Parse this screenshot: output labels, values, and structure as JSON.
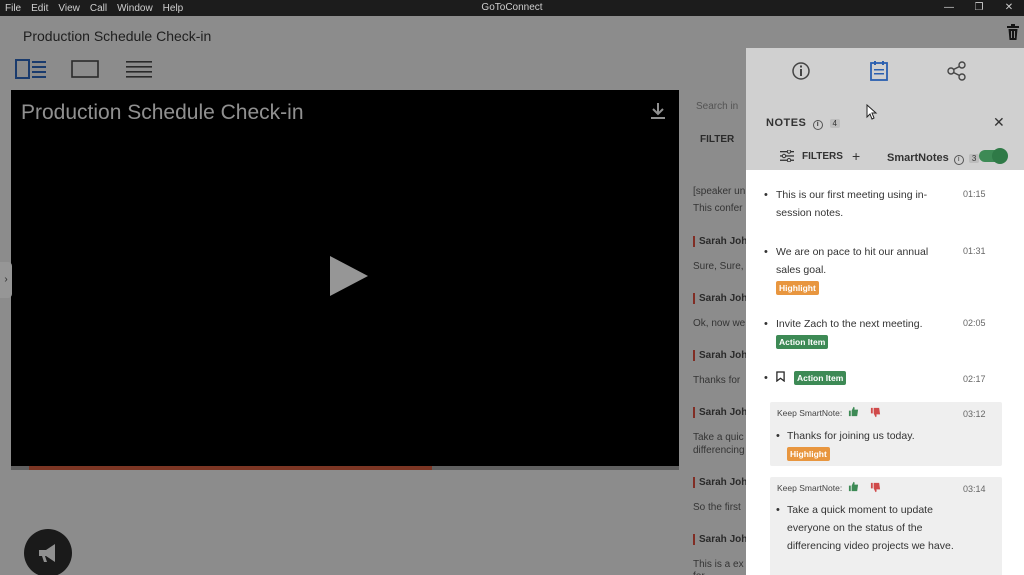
{
  "menu": {
    "items": [
      "File",
      "Edit",
      "View",
      "Call",
      "Window",
      "Help"
    ],
    "app_title": "GoToConnect"
  },
  "window_controls": {
    "minimize": "—",
    "restore": "❐",
    "close": "✕"
  },
  "page": {
    "title": "Production Schedule Check-in"
  },
  "video": {
    "title": "Production Schedule Check-in",
    "progress": 0.62
  },
  "left_tab": {
    "glyph": "›"
  },
  "transcript": {
    "search_hint": "Search in",
    "filters_label": "FILTER",
    "rows": [
      {
        "text": "[speaker un",
        "bold": false
      },
      {
        "text": "This confer",
        "bold": false
      },
      {
        "text": "Sarah Joh",
        "bold": true
      },
      {
        "text": "Sure, Sure,",
        "bold": false
      },
      {
        "text": "Sarah Joh",
        "bold": true
      },
      {
        "text": "Ok, now we",
        "bold": false
      },
      {
        "text": "Sarah Joh",
        "bold": true
      },
      {
        "text": "Thanks for",
        "bold": false
      },
      {
        "text": "Sarah Joh",
        "bold": true
      },
      {
        "text": "Take a quic",
        "bold": false
      },
      {
        "text": "differencing",
        "bold": false
      },
      {
        "text": "Sarah Joh",
        "bold": true
      },
      {
        "text": "So the first",
        "bold": false
      },
      {
        "text": "Sarah Joh",
        "bold": true
      },
      {
        "text": "This is a ex",
        "bold": false
      },
      {
        "text": "for.",
        "bold": false
      }
    ]
  },
  "notes": {
    "heading": "NOTES",
    "count": "4",
    "close": "✕",
    "filters_label": "FILTERS",
    "add": "+",
    "smartnotes_label": "SmartNotes",
    "smartnotes_count": "3",
    "smartnotes_enabled": true,
    "items": [
      {
        "text": "This is our first meeting using in-session notes.",
        "time": "01:15",
        "tag": ""
      },
      {
        "text": "We are on pace to hit our annual sales goal.",
        "time": "01:31",
        "tag": "Highlight"
      },
      {
        "text": "Invite Zach to the next meeting.",
        "time": "02:05",
        "tag": "Action Item"
      },
      {
        "text": "",
        "time": "02:17",
        "tag": "Action Item"
      }
    ],
    "smart_cards": [
      {
        "keep_label": "Keep SmartNote:",
        "time": "03:12",
        "text": "Thanks for joining us today.",
        "tag": "Highlight"
      },
      {
        "keep_label": "Keep SmartNote:",
        "time": "03:14",
        "text": "Take a quick moment to update everyone on the status of the differencing video projects we have.",
        "tag": ""
      }
    ]
  },
  "colors": {
    "highlight": "#e8963f",
    "action_item": "#3d8a55",
    "progress": "#c8583a",
    "accent_blue": "#2a5fb0"
  }
}
